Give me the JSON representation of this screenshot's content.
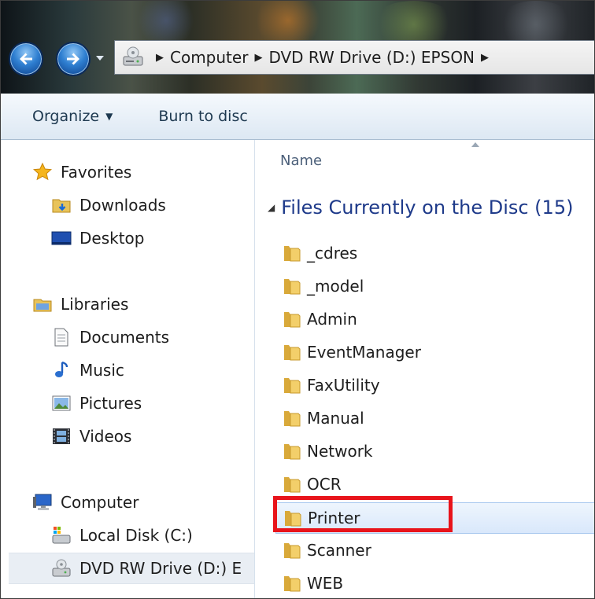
{
  "address_bar": {
    "breadcrumbs": [
      "Computer",
      "DVD RW Drive (D:) EPSON"
    ],
    "location_icon": "dvd-drive-icon"
  },
  "navigation_buttons": {
    "back_icon": "back-arrow-icon",
    "forward_icon": "forward-arrow-icon",
    "history_icon": "chevron-down-icon"
  },
  "toolbar": {
    "organize_label": "Organize",
    "burn_label": "Burn to disc"
  },
  "sidebar": {
    "favorites": {
      "label": "Favorites",
      "icon": "star-icon",
      "items": [
        {
          "label": "Downloads",
          "icon": "downloads-folder-icon"
        },
        {
          "label": "Desktop",
          "icon": "desktop-icon"
        }
      ]
    },
    "libraries": {
      "label": "Libraries",
      "icon": "libraries-icon",
      "items": [
        {
          "label": "Documents",
          "icon": "document-icon"
        },
        {
          "label": "Music",
          "icon": "music-note-icon"
        },
        {
          "label": "Pictures",
          "icon": "picture-icon"
        },
        {
          "label": "Videos",
          "icon": "film-icon"
        }
      ]
    },
    "computer": {
      "label": "Computer",
      "icon": "computer-icon",
      "items": [
        {
          "label": "Local Disk (C:)",
          "icon": "local-disk-icon"
        },
        {
          "label": "DVD RW Drive (D:) E",
          "icon": "dvd-drive-icon",
          "selected": true
        }
      ]
    }
  },
  "content": {
    "column_header": "Name",
    "group_title": "Files Currently on the Disc (15)",
    "files": [
      {
        "name": "_cdres"
      },
      {
        "name": "_model"
      },
      {
        "name": "Admin"
      },
      {
        "name": "EventManager"
      },
      {
        "name": "FaxUtility"
      },
      {
        "name": "Manual"
      },
      {
        "name": "Network"
      },
      {
        "name": "OCR"
      },
      {
        "name": "Printer",
        "highlighted": true
      },
      {
        "name": "Scanner"
      },
      {
        "name": "WEB"
      }
    ]
  },
  "colors": {
    "group_title": "#1e3a8a",
    "callout_border": "#e8141b",
    "selection_fill": "#d9e8fb"
  }
}
